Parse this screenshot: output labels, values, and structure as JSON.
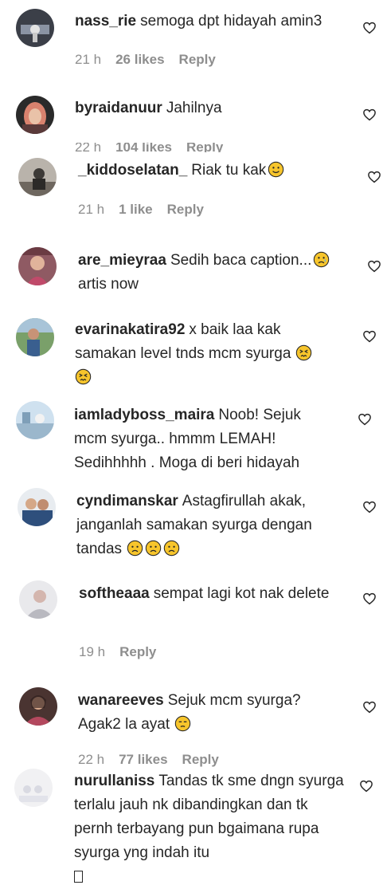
{
  "comments": [
    {
      "username": "nass_rie",
      "text": "semoga dpt hidayah amin3",
      "time": "21 h",
      "likes": "26 likes",
      "reply": "Reply"
    },
    {
      "username": "byraidanuur",
      "text": "Jahilnya",
      "time": "22 h",
      "likes": "104 likes",
      "reply": "Reply"
    },
    {
      "username": "_kiddoselatan_",
      "text": "Riak tu kak",
      "emoji": "slightly-smiling-face",
      "time": "21 h",
      "likes": "1 like",
      "reply": "Reply"
    },
    {
      "username": "are_mieyraa",
      "text": "Sedih baca caption...",
      "emoji": "crying-face",
      "text2": "artis now"
    },
    {
      "username": "evarinakatira92",
      "text": "x baik laa kak samakan level tnds mcm syurga",
      "emoji": "persevering-face"
    },
    {
      "username": "iamladyboss_maira",
      "text": "Noob! Sejuk mcm syurga.. hmmm LEMAH! Sedihhhhh . Moga di beri hidayah"
    },
    {
      "username": "cyndimanskar",
      "text": "Astagfirullah akak, janganlah samakan syurga dengan tandas",
      "emoji": "frowning-face"
    },
    {
      "username": "softheaaa",
      "text": "sempat lagi kot nak delete",
      "time": "19 h",
      "reply": "Reply"
    },
    {
      "username": "wanareeves",
      "text": "Sejuk mcm syurga? Agak2 la ayat",
      "emoji": "unamused-face",
      "time": "22 h",
      "likes": "77 likes",
      "reply": "Reply"
    },
    {
      "username": "nurullaniss",
      "text": "Tandas tk sme dngn syurga terlalu jauh nk dibandingkan dan tk pernh terbayang pun bgaimana rupa syurga yng indah itu"
    }
  ],
  "icons": {
    "like": "heart-outline-icon"
  },
  "colors": {
    "text": "#262626",
    "meta": "#8e8e8e",
    "emoji": "#f7c52c"
  }
}
